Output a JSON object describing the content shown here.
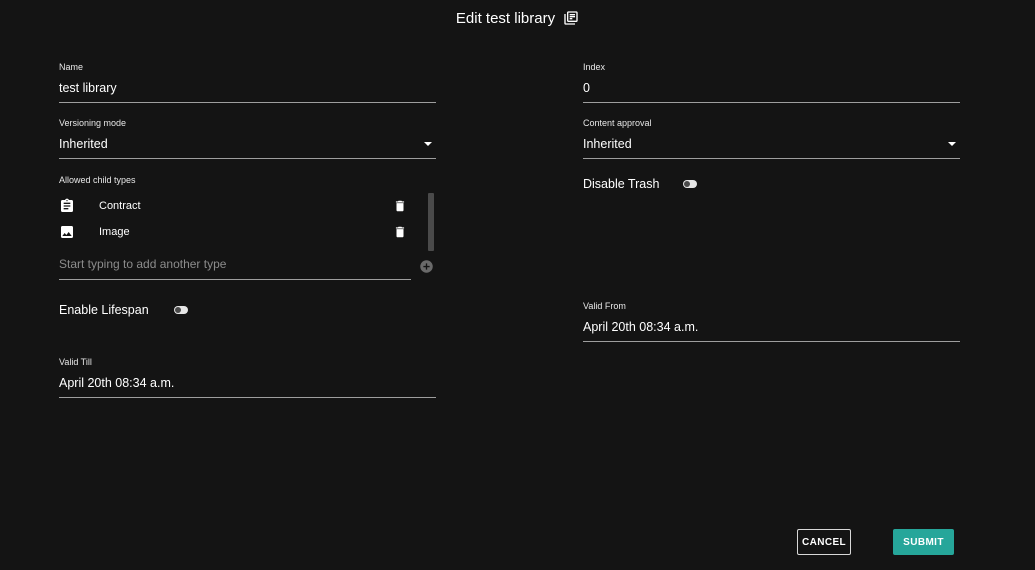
{
  "header": {
    "title": "Edit test library",
    "icon": "library-books-icon"
  },
  "fields": {
    "name": {
      "label": "Name",
      "value": "test library"
    },
    "index": {
      "label": "Index",
      "value": "0"
    },
    "versioning_mode": {
      "label": "Versioning mode",
      "value": "Inherited"
    },
    "content_approval": {
      "label": "Content approval",
      "value": "Inherited"
    },
    "valid_from": {
      "label": "Valid From",
      "value": "April 20th 08:34 a.m."
    },
    "valid_till": {
      "label": "Valid Till",
      "value": "April 20th 08:34 a.m."
    }
  },
  "allowed_child_types": {
    "label": "Allowed child types",
    "items": [
      {
        "name": "Contract",
        "icon": "clipboard-icon"
      },
      {
        "name": "Image",
        "icon": "image-icon"
      }
    ],
    "add_placeholder": "Start typing to add another type"
  },
  "toggles": {
    "disable_trash": {
      "label": "Disable Trash",
      "on": false
    },
    "enable_lifespan": {
      "label": "Enable Lifespan",
      "on": false
    }
  },
  "buttons": {
    "cancel": "CANCEL",
    "submit": "SUBMIT"
  },
  "colors": {
    "background": "#141414",
    "accent": "#26a69a",
    "underline": "#9e9e9e"
  }
}
